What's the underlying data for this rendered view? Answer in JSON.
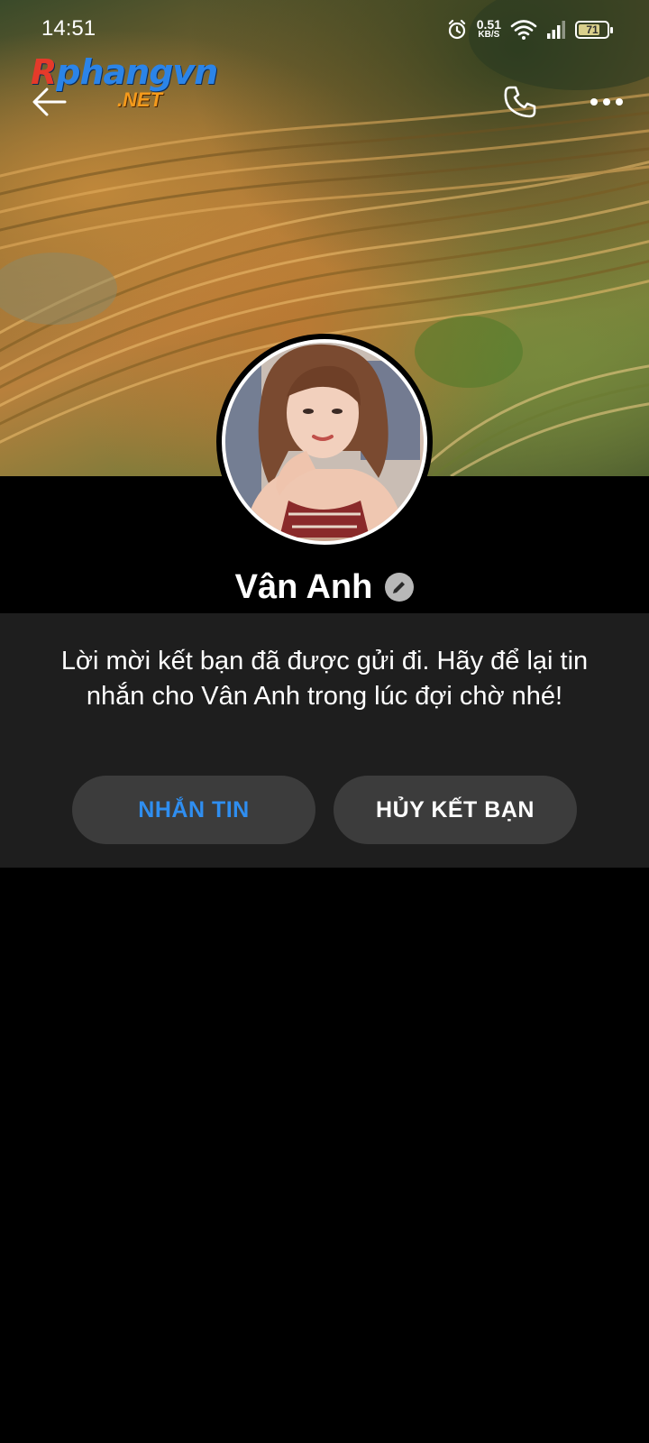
{
  "status_bar": {
    "time": "14:51",
    "net_speed": "0.51",
    "net_unit": "KB/S",
    "battery": "71"
  },
  "watermark": {
    "brand_first": "R",
    "brand_rest": "phangvn",
    "tld": ".NET"
  },
  "profile": {
    "name": "Vân Anh"
  },
  "request": {
    "message": "Lời mời kết bạn đã được gửi đi. Hãy để lại tin nhắn cho Vân Anh trong lúc đợi chờ nhé!",
    "message_button": "NHẮN TIN",
    "cancel_button": "HỦY KẾT BẠN"
  },
  "colors": {
    "accent": "#2f8ef0",
    "panel": "#1e1e1e",
    "button": "#3c3c3c"
  }
}
